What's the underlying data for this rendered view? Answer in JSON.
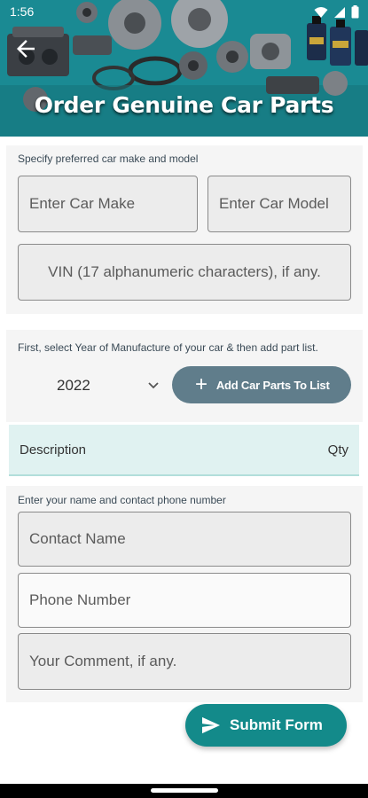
{
  "status_bar": {
    "time": "1:56"
  },
  "header": {
    "title": "Order Genuine Car Parts"
  },
  "car_section": {
    "label": "Specify preferred car make and model",
    "make_placeholder": "Enter Car Make",
    "model_placeholder": "Enter Car Model",
    "vin_placeholder": "VIN (17 alphanumeric characters), if any."
  },
  "parts_section": {
    "label": "First, select Year of Manufacture of your car & then add part list.",
    "year_value": "2022",
    "add_button_label": "Add Car Parts To List",
    "list_header": {
      "description": "Description",
      "qty": "Qty"
    }
  },
  "contact_section": {
    "label": "Enter your name and contact phone number",
    "name_placeholder": "Contact Name",
    "phone_placeholder": "Phone Number",
    "comment_placeholder": "Your Comment, if any."
  },
  "submit_label": "Submit Form",
  "colors": {
    "header_teal": "#1a8a93",
    "add_button": "#607d8b",
    "submit_button": "#138a8a",
    "list_header_bg": "#e0f2f1"
  }
}
